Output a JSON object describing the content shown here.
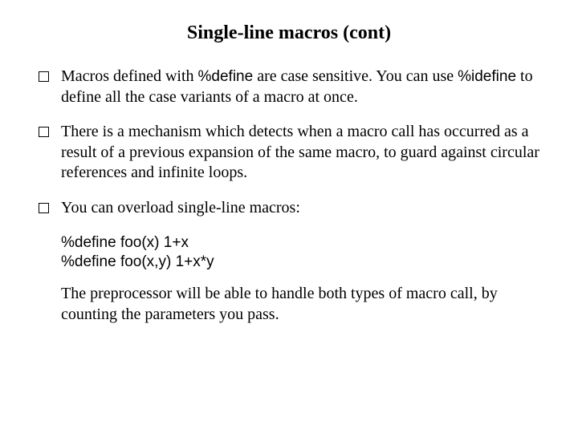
{
  "title": "Single-line macros (cont)",
  "bullets": [
    {
      "pre1": "Macros defined with ",
      "code1": "%define",
      "mid1": " are case sensitive. You can use ",
      "code2": "%idefine",
      "post1": " to define all the case variants of a macro at once."
    },
    {
      "text": "There is a mechanism which detects when a macro call has occurred as a result of a previous expansion of the same macro, to guard against circular references and infinite loops."
    },
    {
      "text": "You can overload single-line macros:"
    }
  ],
  "code_lines": "%define foo(x) 1+x\n%define foo(x,y) 1+x*y",
  "followup": "The preprocessor will be able to handle both types of macro call, by counting the parameters you pass."
}
